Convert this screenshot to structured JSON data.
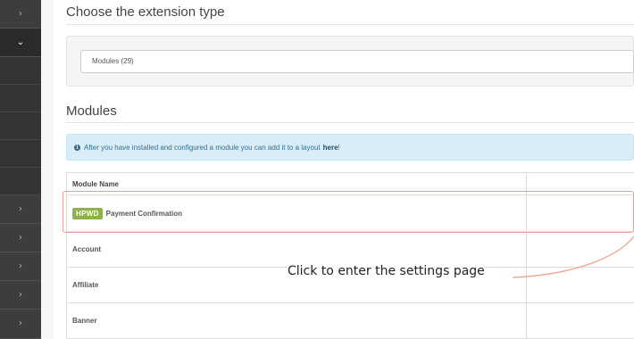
{
  "sidebar": {
    "items": [
      {
        "icon": "chevron-right-icon",
        "glyph": "›",
        "state": "collapsed"
      },
      {
        "icon": "chevron-down-icon",
        "glyph": "⌄",
        "state": "expanded"
      },
      {
        "icon": "none",
        "glyph": "",
        "state": "sub"
      },
      {
        "icon": "none",
        "glyph": "",
        "state": "sub"
      },
      {
        "icon": "none",
        "glyph": "",
        "state": "sub"
      },
      {
        "icon": "none",
        "glyph": "",
        "state": "sub"
      },
      {
        "icon": "none",
        "glyph": "",
        "state": "sub"
      },
      {
        "icon": "chevron-right-icon",
        "glyph": "›",
        "state": "collapsed"
      },
      {
        "icon": "chevron-right-icon",
        "glyph": "›",
        "state": "collapsed"
      },
      {
        "icon": "chevron-right-icon",
        "glyph": "›",
        "state": "collapsed"
      },
      {
        "icon": "chevron-right-icon",
        "glyph": "›",
        "state": "collapsed"
      },
      {
        "icon": "chevron-right-icon",
        "glyph": "›",
        "state": "collapsed"
      }
    ]
  },
  "extension_type": {
    "heading": "Choose the extension type",
    "selected": "Modules (29)"
  },
  "modules": {
    "heading": "Modules",
    "alert_text": "After you have installed and configured a module you can add it to a layout",
    "alert_link": "here",
    "alert_suffix": "!",
    "table": {
      "column_header": "Module Name",
      "rows": [
        {
          "badge": "HPWD",
          "name": "Payment Confirmation",
          "highlighted": true
        },
        {
          "badge": "",
          "name": "Account",
          "highlighted": false
        },
        {
          "badge": "",
          "name": "Affiliate",
          "highlighted": false
        },
        {
          "badge": "",
          "name": "Banner",
          "highlighted": false
        }
      ]
    }
  },
  "annotation": {
    "callout_text": "Click to enter the settings page"
  },
  "colors": {
    "sidebar_bg": "#3d3d3d",
    "alert_bg": "#d9edf7",
    "badge_bg": "#8fb14b",
    "highlight_stroke": "#f2a091"
  }
}
